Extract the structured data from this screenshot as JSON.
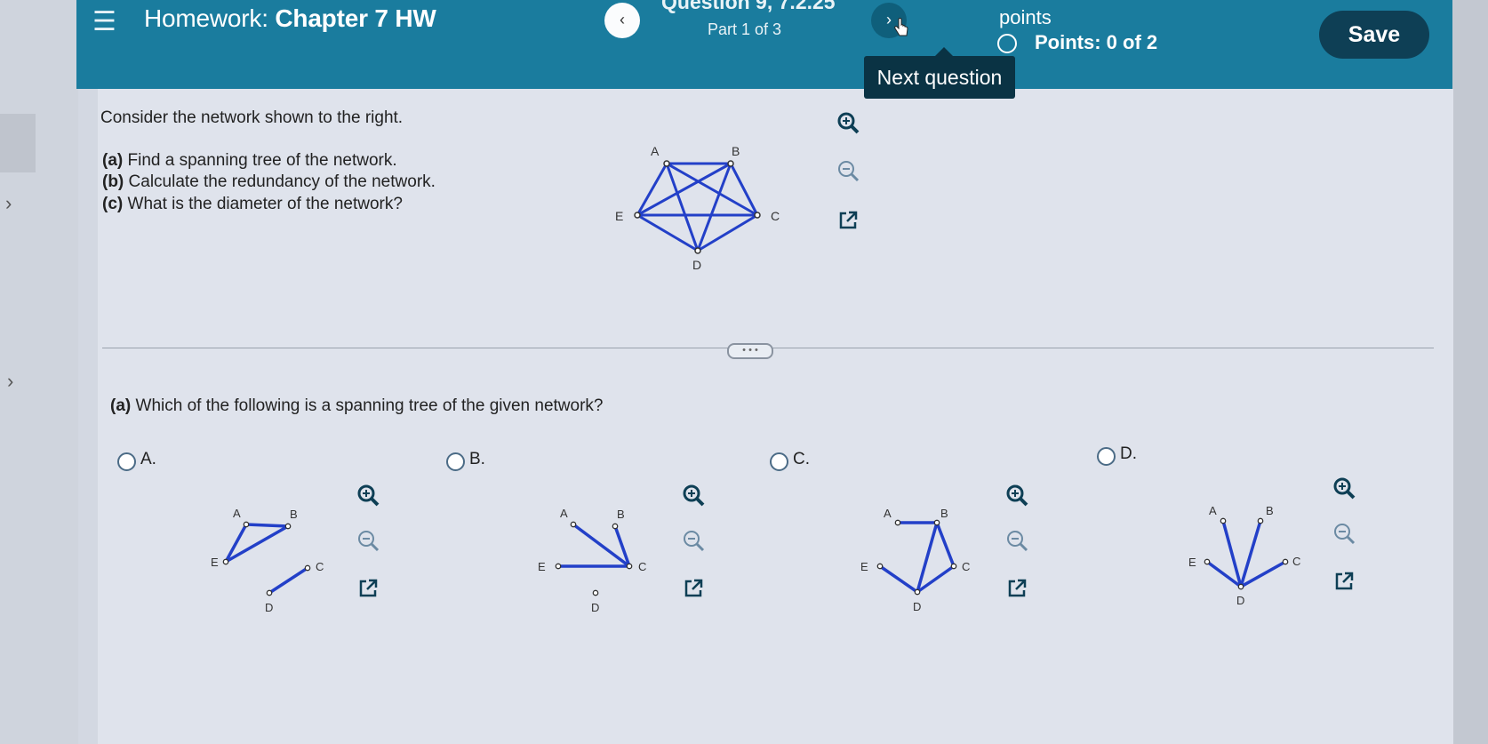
{
  "header": {
    "title_prefix": "Homework:",
    "title_main": "Chapter 7 HW",
    "question_title": "Question 9, 7.2.25",
    "part": "Part 1 of 3",
    "points_label": "points",
    "points_value": "Points: 0 of 2",
    "save_label": "Save",
    "tooltip": "Next question",
    "prev_glyph": "‹",
    "next_glyph": "›",
    "menu_glyph": "☰"
  },
  "problem": {
    "intro": "Consider the network shown to the right.",
    "parts": [
      {
        "tag": "(a)",
        "text": " Find a spanning tree of the network."
      },
      {
        "tag": "(b)",
        "text": " Calculate the redundancy of the network."
      },
      {
        "tag": "(c)",
        "text": " What is the diameter of the network?"
      }
    ]
  },
  "network_labels": {
    "A": "A",
    "B": "B",
    "C": "C",
    "D": "D",
    "E": "E"
  },
  "question_a": {
    "tag": "(a)",
    "text": " Which of the following is a spanning tree of the given network?",
    "options": [
      {
        "letter": "A."
      },
      {
        "letter": "B."
      },
      {
        "letter": "C."
      },
      {
        "letter": "D."
      }
    ]
  },
  "colors": {
    "header": "#1a7c9e",
    "edge_blue": "#2340c8",
    "save": "#0e3f55"
  },
  "icons": [
    "menu-icon",
    "prev-arrow-icon",
    "next-arrow-icon",
    "zoom-in-icon",
    "zoom-out-icon",
    "open-new-window-icon"
  ]
}
